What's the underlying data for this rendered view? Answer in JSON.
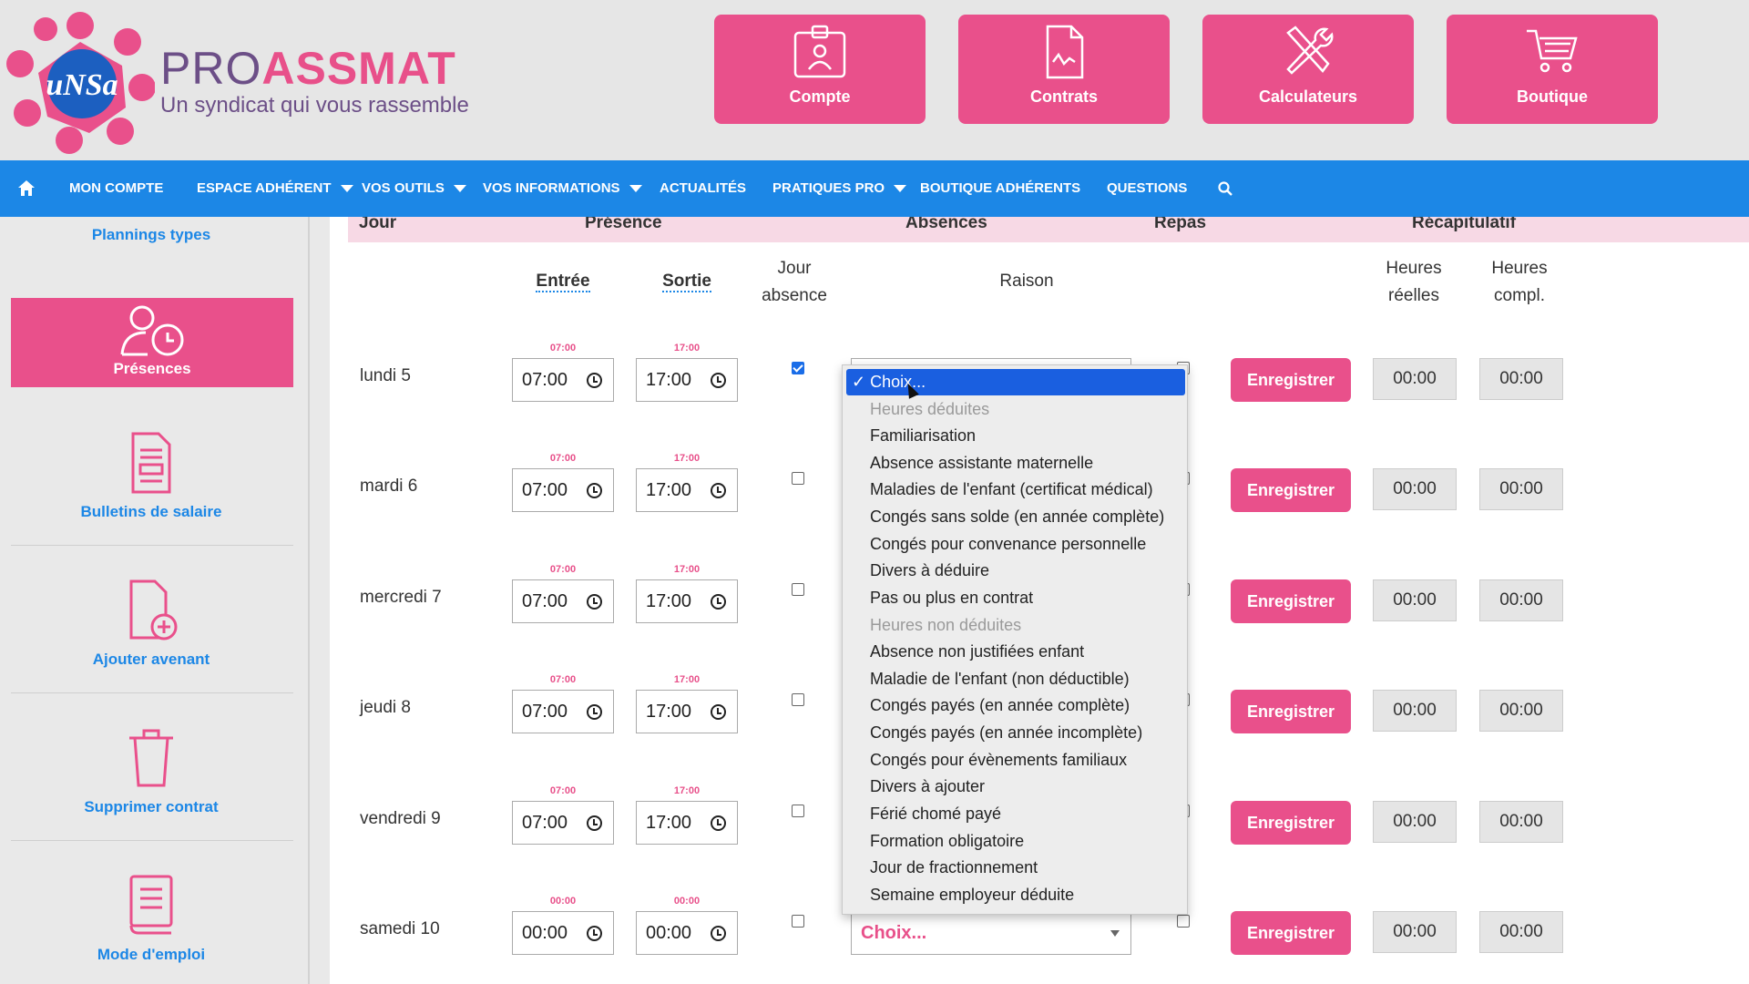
{
  "brand": {
    "pro": "PRO",
    "assmat": "ASSMAT",
    "tagline": "Un syndicat qui vous rassemble",
    "logo_text": "uNSa"
  },
  "header_buttons": [
    {
      "label": "Compte",
      "icon": "account-card-icon"
    },
    {
      "label": "Contrats",
      "icon": "contract-document-icon"
    },
    {
      "label": "Calculateurs",
      "icon": "tools-icon"
    },
    {
      "label": "Boutique",
      "icon": "cart-icon"
    }
  ],
  "nav": {
    "items": [
      {
        "label": "MON COMPTE"
      },
      {
        "label": "ESPACE ADHÉRENT"
      },
      {
        "label": "VOS OUTILS"
      },
      {
        "label": "VOS INFORMATIONS"
      },
      {
        "label": "ACTUALITÉS"
      },
      {
        "label": "PRATIQUES PRO"
      },
      {
        "label": "BOUTIQUE ADHÉRENTS"
      },
      {
        "label": "QUESTIONS"
      }
    ]
  },
  "sidebar": {
    "items": [
      {
        "label": "Plannings types"
      },
      {
        "label": "Présences"
      },
      {
        "label": "Bulletins de salaire"
      },
      {
        "label": "Ajouter avenant"
      },
      {
        "label": "Supprimer contrat"
      },
      {
        "label": "Mode d'emploi"
      }
    ]
  },
  "table": {
    "group_headers": [
      "Jour",
      "Présence",
      "Absences",
      "Repas",
      "Récapitulatif"
    ],
    "columns": {
      "entree": "Entrée",
      "sortie": "Sortie",
      "jour_absence_1": "Jour",
      "jour_absence_2": "absence",
      "raison": "Raison",
      "heures_reelles_1": "Heures",
      "heures_reelles_2": "réelles",
      "heures_compl_1": "Heures",
      "heures_compl_2": "compl."
    },
    "save_label": "Enregistrer",
    "rows": [
      {
        "day": "lundi 5",
        "in_hint": "07:00",
        "in": "07:00",
        "out_hint": "17:00",
        "out": "17:00",
        "absence": true,
        "reels": "00:00",
        "compl": "00:00"
      },
      {
        "day": "mardi 6",
        "in_hint": "07:00",
        "in": "07:00",
        "out_hint": "17:00",
        "out": "17:00",
        "absence": false,
        "reels": "00:00",
        "compl": "00:00"
      },
      {
        "day": "mercredi 7",
        "in_hint": "07:00",
        "in": "07:00",
        "out_hint": "17:00",
        "out": "17:00",
        "absence": false,
        "reels": "00:00",
        "compl": "00:00"
      },
      {
        "day": "jeudi 8",
        "in_hint": "07:00",
        "in": "07:00",
        "out_hint": "17:00",
        "out": "17:00",
        "absence": false,
        "reels": "00:00",
        "compl": "00:00"
      },
      {
        "day": "vendredi 9",
        "in_hint": "07:00",
        "in": "07:00",
        "out_hint": "17:00",
        "out": "17:00",
        "absence": false,
        "reels": "00:00",
        "compl": "00:00"
      },
      {
        "day": "samedi 10",
        "in_hint": "00:00",
        "in": "00:00",
        "out_hint": "00:00",
        "out": "00:00",
        "absence": false,
        "reels": "00:00",
        "compl": "00:00",
        "reason": "Choix..."
      }
    ]
  },
  "dropdown": {
    "options": [
      {
        "label": "✓ Choix...",
        "state": "selected"
      },
      {
        "label": "Heures déduites",
        "state": "disabled"
      },
      {
        "label": "Familiarisation",
        "state": ""
      },
      {
        "label": "Absence assistante maternelle",
        "state": ""
      },
      {
        "label": "Maladies de l'enfant (certificat médical)",
        "state": ""
      },
      {
        "label": "Congés sans solde (en année complète)",
        "state": ""
      },
      {
        "label": "Congés pour convenance personnelle",
        "state": ""
      },
      {
        "label": "Divers à déduire",
        "state": ""
      },
      {
        "label": "Pas ou plus en contrat",
        "state": ""
      },
      {
        "label": "Heures non déduites",
        "state": "disabled"
      },
      {
        "label": "Absence non justifiées enfant",
        "state": ""
      },
      {
        "label": "Maladie de l'enfant (non déductible)",
        "state": ""
      },
      {
        "label": "Congés payés (en année complète)",
        "state": ""
      },
      {
        "label": "Congés payés (en année incomplète)",
        "state": ""
      },
      {
        "label": "Congés pour évènements familiaux",
        "state": ""
      },
      {
        "label": "Divers à ajouter",
        "state": ""
      },
      {
        "label": "Férié chomé payé",
        "state": ""
      },
      {
        "label": "Formation obligatoire",
        "state": ""
      },
      {
        "label": "Jour de fractionnement",
        "state": ""
      },
      {
        "label": "Semaine employeur déduite",
        "state": ""
      }
    ]
  },
  "colors": {
    "pink": "#e9508b",
    "blue": "#1c87e6",
    "purple": "#6c4f87"
  }
}
